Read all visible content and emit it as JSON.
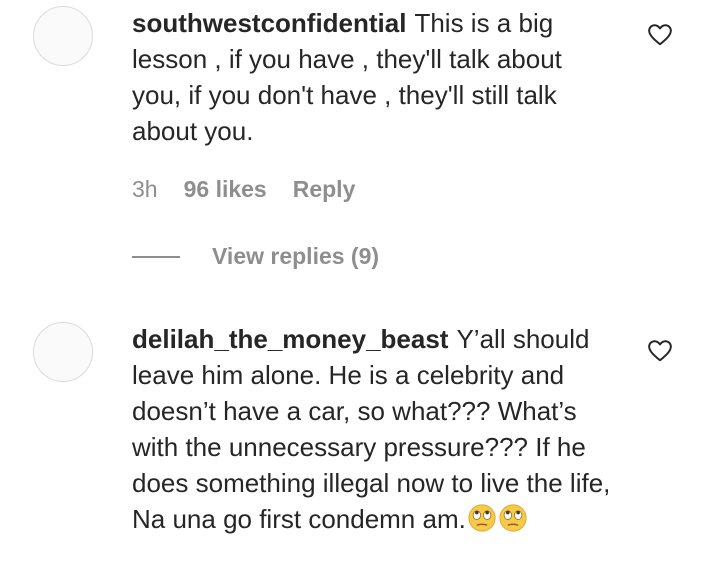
{
  "comments": [
    {
      "username": "southwestconfidential",
      "text": "This is a big lesson , if you have , they'll talk about you, if you don't have , they'll still talk about you.",
      "time": "3h",
      "likes": "96 likes",
      "reply_label": "Reply",
      "view_replies_label": "View replies (9)",
      "icon": "heart-outline-icon"
    },
    {
      "username": "delilah_the_money_beast",
      "text": "Y’all should leave him alone. He is a celebrity and doesn’t have a car, so what??? What’s with the unnecessary pressure??? If he does something illegal now to live the life, Na una go first condemn am.",
      "emoji": [
        "face-with-rolling-eyes",
        "face-with-rolling-eyes"
      ],
      "icon": "heart-outline-icon"
    }
  ],
  "colors": {
    "text": "#262626",
    "secondary": "#8e8e8e",
    "avatar_border": "#dbdbdb",
    "emoji_face": "#f7c948"
  }
}
